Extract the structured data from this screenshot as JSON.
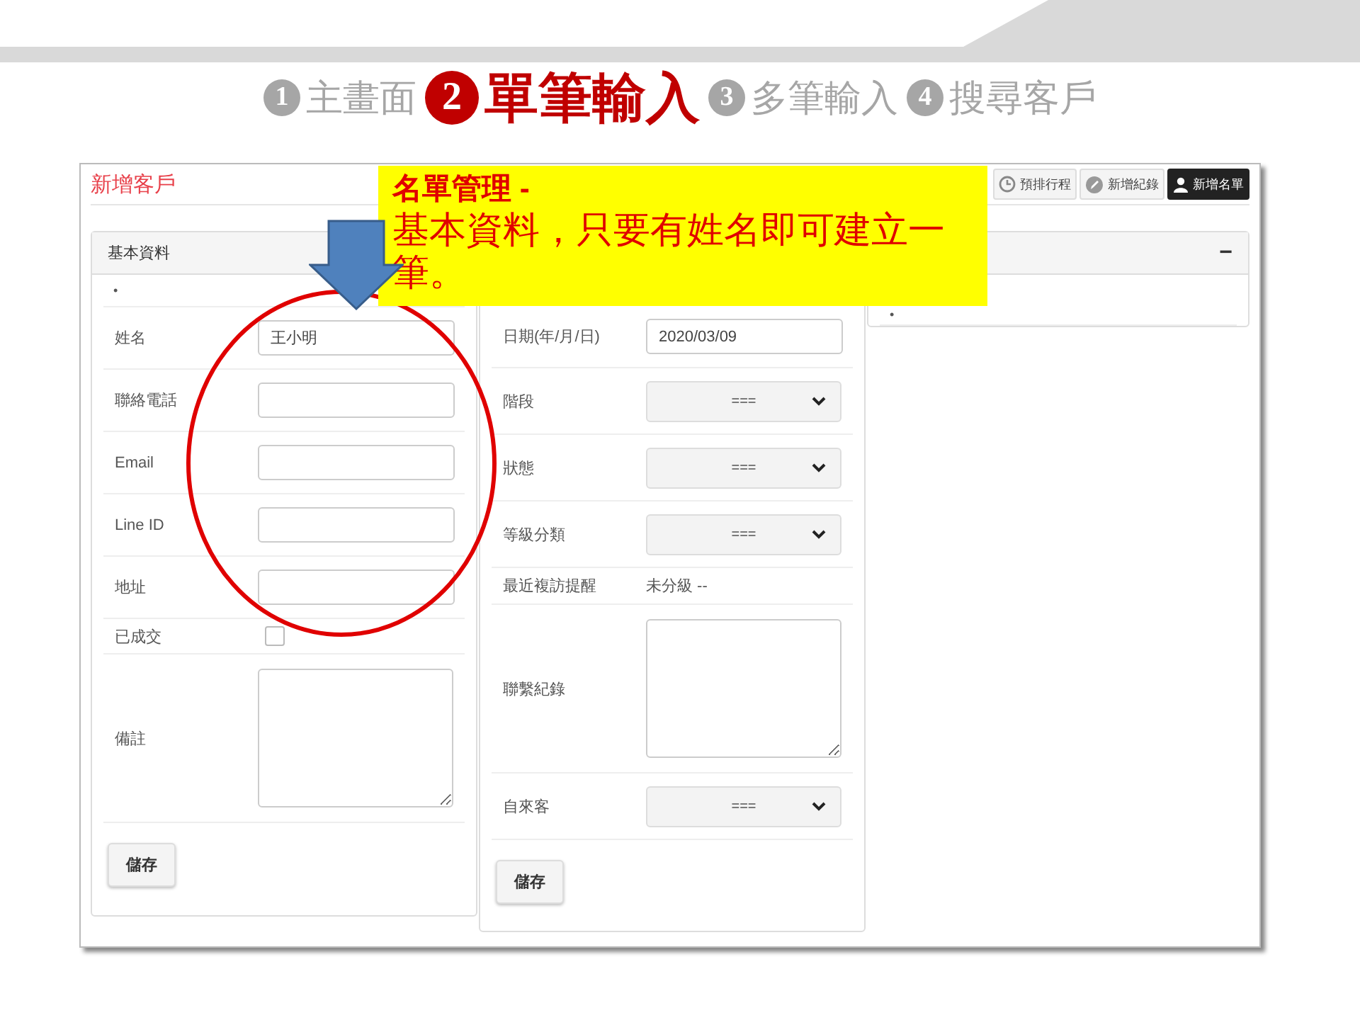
{
  "steps": [
    {
      "number": "1",
      "label": "主畫面",
      "selected": false
    },
    {
      "number": "2",
      "label": "單筆輸入",
      "selected": true
    },
    {
      "number": "3",
      "label": "多筆輸入",
      "selected": false
    },
    {
      "number": "4",
      "label": "搜尋客戶",
      "selected": false
    }
  ],
  "app": {
    "title": "新增客戶",
    "toolbar": [
      {
        "kind": "clock",
        "label": "預排行程",
        "selected": false
      },
      {
        "kind": "pencil",
        "label": "新增紀錄",
        "selected": false
      },
      {
        "kind": "person",
        "label": "新增名單",
        "selected": true
      }
    ],
    "panels": [
      {
        "header": "基本資料",
        "note": "•",
        "rows": [
          {
            "kind": "text",
            "label": "姓名",
            "value": "王小明"
          },
          {
            "kind": "text",
            "label": "聯絡電話"
          },
          {
            "kind": "text",
            "label": "Email"
          },
          {
            "kind": "text",
            "label": "Line ID"
          },
          {
            "kind": "text",
            "label": "地址"
          },
          {
            "kind": "checkbox",
            "label": "已成交",
            "checked": false
          },
          {
            "kind": "textarea",
            "label": "備註"
          }
        ],
        "save": "儲存"
      },
      {
        "rows": [
          {
            "kind": "text",
            "label": "日期(年/月/日)",
            "value": "2020/03/09"
          },
          {
            "kind": "select",
            "label": "階段",
            "value": "==="
          },
          {
            "kind": "select",
            "label": "狀態",
            "value": "==="
          },
          {
            "kind": "select",
            "label": "等級分類",
            "value": "==="
          },
          {
            "kind": "static",
            "label": "最近複訪提醒",
            "value": "未分級 --"
          },
          {
            "kind": "textarea",
            "label": "聯繫紀錄"
          },
          {
            "kind": "select",
            "label": "自來客",
            "value": "==="
          }
        ],
        "save": "儲存"
      },
      {
        "collapse": "−",
        "note": "•"
      }
    ]
  },
  "callout": {
    "title": "名單管理 -",
    "text": "基本資料，只要有姓名即可建立一筆。"
  }
}
